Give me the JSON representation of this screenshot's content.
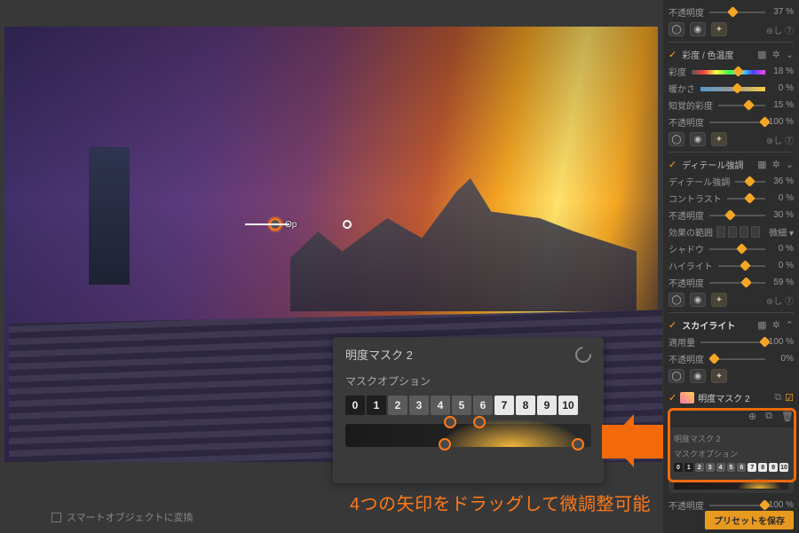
{
  "pin_label": "Op",
  "popup": {
    "title": "明度マスク 2",
    "subtitle": "マスクオプション",
    "numbers": [
      "0",
      "1",
      "2",
      "3",
      "4",
      "5",
      "6",
      "7",
      "8",
      "9",
      "10"
    ]
  },
  "annotation": "4つの矢印をドラッグして微調整可能",
  "footer_left": "スマートオブジェクトに変換",
  "sidebar": {
    "s1": {
      "opacity_label": "不透明度",
      "opacity_val": "37 %",
      "help": "⊛し ⑦"
    },
    "s2": {
      "title": "彩度 / 色温度",
      "sat_label": "彩度",
      "sat_val": "18 %",
      "warm_label": "暖かさ",
      "warm_val": "0 %",
      "vib_label": "知覚的彩度",
      "vib_val": "15 %",
      "opacity_label": "不透明度",
      "opacity_val": "100 %"
    },
    "s3": {
      "title": "ディテール強調",
      "det_label": "ディテール強調",
      "det_val": "36 %",
      "con_label": "コントラスト",
      "con_val": "0 %",
      "opa_label": "不透明度",
      "opa_val": "30 %",
      "range_label": "効果の範囲",
      "range_btn": "微細 ▾",
      "sh_label": "シャドウ",
      "sh_val": "0 %",
      "hi_label": "ハイライト",
      "hi_val": "0 %",
      "op2_label": "不透明度",
      "op2_val": "59 %"
    },
    "s4": {
      "title": "スカイライト",
      "amt_label": "適用量",
      "amt_val": "100 %",
      "op_label": "不透明度",
      "op_val": "0%"
    },
    "mask": {
      "label": "明度マスク 2",
      "mini_title": "明度マスク 2",
      "mini_sub": "マスクオプション",
      "numbers": [
        "0",
        "1",
        "2",
        "3",
        "4",
        "5",
        "6",
        "7",
        "8",
        "9",
        "10"
      ],
      "bottom_op_label": "不透明度",
      "bottom_op_val": "100 %"
    },
    "save_btn": "プリセットを保存"
  }
}
